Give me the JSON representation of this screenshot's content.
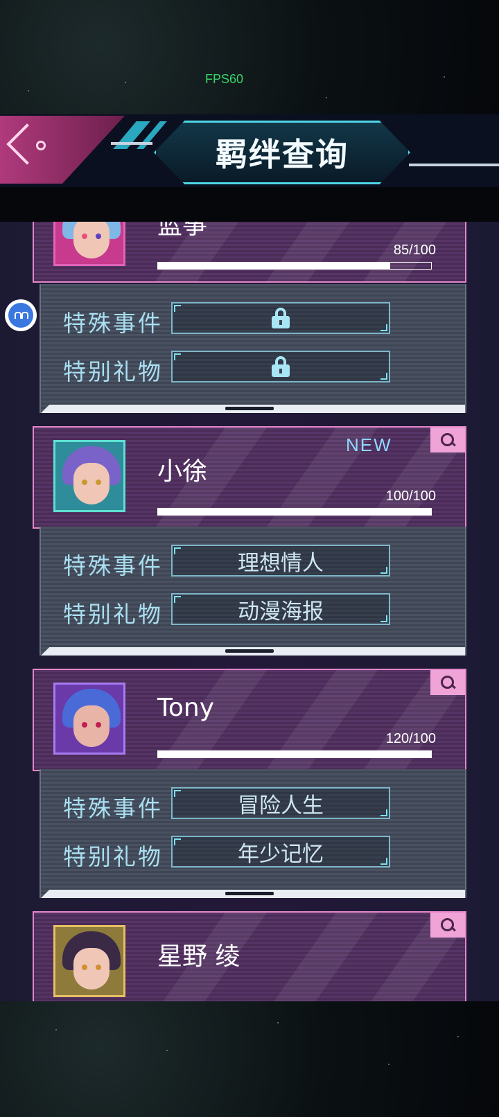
{
  "status": {
    "fps": "FPS60"
  },
  "header": {
    "title": "羁绊查询"
  },
  "labels": {
    "special_event": "特殊事件",
    "special_gift": "特别礼物"
  },
  "colors": {
    "card_border": "#e487c9",
    "accent_teal": "#4ed6e6",
    "search_button": "#f0a3d6",
    "new_badge": "#8fd8ff"
  },
  "characters": [
    {
      "name": "蓝筝",
      "score": "85/100",
      "progress": 0.85,
      "new_badge": "",
      "event": "locked",
      "gift": "locked"
    },
    {
      "name": "小徐",
      "score": "100/100",
      "progress": 1.0,
      "new_badge": "NEW",
      "event": "理想情人",
      "gift": "动漫海报"
    },
    {
      "name": "Tony",
      "score": "120/100",
      "progress": 1.0,
      "new_badge": "",
      "event": "冒险人生",
      "gift": "年少记忆"
    },
    {
      "name": "星野 绫",
      "score": "",
      "progress": 0,
      "new_badge": "",
      "event": "",
      "gift": ""
    }
  ]
}
